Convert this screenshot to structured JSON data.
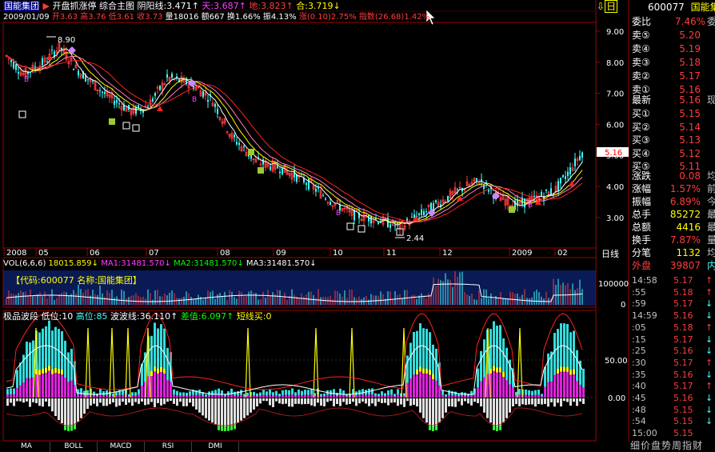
{
  "header": {
    "stock_name": "国能集团",
    "arrow": "▶",
    "items": [
      "开盘抓涨停",
      "综合主图"
    ],
    "yinyang_label": "阴阳线:",
    "yinyang_value": "3.471",
    "tian_label": "天:",
    "tian_value": "3.687",
    "di_label": "地:",
    "di_value": "3.823",
    "he_label": "合:",
    "he_value": "3.719",
    "top_right_icon": "⇩",
    "top_right_text": "日"
  },
  "ohlc": {
    "date": "2009/01/09",
    "open_label": "开",
    "open": "3.63",
    "high_label": "高",
    "high": "3.76",
    "low_label": "低",
    "low": "3.61",
    "close_label": "收",
    "close": "3.73",
    "vol_label": "量",
    "vol": "18016",
    "amt_label": "额",
    "amt": "667",
    "turn_label": "换",
    "turn": "1.66%",
    "amp_label": "振",
    "amp": "4.13%",
    "chg_label": "涨",
    "chg": "(0.10)2.75%",
    "idx_label": "指数",
    "idx": "(26.68)1.42%"
  },
  "price_chart": {
    "y_ticks": [
      "9.00",
      "8.00",
      "7.00",
      "6.00",
      "5.00",
      "4.00",
      "3.00"
    ],
    "current_price": "5.16",
    "max_label": "8.90",
    "min_label": "2.44",
    "x_labels": [
      "2008",
      "05",
      "06",
      "07",
      "08",
      "09",
      "10",
      "11",
      "12",
      "2009",
      "02"
    ],
    "period": "日线"
  },
  "volume": {
    "label": "VOL(6,6,6)",
    "vol": "18015.859",
    "ma1_label": "MA1:",
    "ma1": "31481.570",
    "ma2_label": "MA2:",
    "ma2": "31481.570",
    "ma3_label": "MA3:",
    "ma3": "31481.570",
    "code_banner": "【代码:600077 名称:国能集团】",
    "y_ticks": [
      "100000",
      "0"
    ]
  },
  "indicator": {
    "name": "极品波段",
    "low_label": "低位:",
    "low": "10",
    "high_label": "高位:",
    "high": "85",
    "wave_label": "波波线:",
    "wave": "36.110",
    "diff_label": "差值:",
    "diff": "6.097",
    "short_label": "短线买:",
    "short": "0",
    "y_ticks": [
      "50.00",
      "0.00"
    ]
  },
  "tabs": [
    "MA",
    "BOLL",
    "MACD",
    "RSI",
    "DMI"
  ],
  "quote": {
    "code": "600077",
    "name": "国能集",
    "weibi_label": "委比",
    "weibi": "7.46%",
    "weicha": "委差",
    "sells": [
      {
        "label": "卖⑤",
        "price": "5.20"
      },
      {
        "label": "卖④",
        "price": "5.19"
      },
      {
        "label": "卖③",
        "price": "5.18"
      },
      {
        "label": "卖②",
        "price": "5.17"
      },
      {
        "label": "卖①",
        "price": "5.16"
      }
    ],
    "latest_label": "最新",
    "latest": "5.16",
    "latest_extra": "现手",
    "buys": [
      {
        "label": "买①",
        "price": "5.15"
      },
      {
        "label": "买②",
        "price": "5.14"
      },
      {
        "label": "买③",
        "price": "5.13"
      },
      {
        "label": "买④",
        "price": "5.12"
      },
      {
        "label": "买⑤",
        "price": "5.11"
      }
    ],
    "stats": [
      {
        "label": "涨跌",
        "value": "0.08",
        "extra": "均价"
      },
      {
        "label": "涨幅",
        "value": "1.57%",
        "extra": "前收"
      },
      {
        "label": "振幅",
        "value": "6.89%",
        "extra": "今开"
      },
      {
        "label": "总手",
        "value": "85272",
        "extra": "最高"
      },
      {
        "label": "总额",
        "value": "4416",
        "extra": "最低"
      },
      {
        "label": "换手",
        "value": "7.87%",
        "extra": "量比"
      },
      {
        "label": "分笔",
        "value": "1132",
        "extra": "均量"
      }
    ],
    "outer_label": "外盘",
    "outer": "39807",
    "inner": "内盘",
    "ticks": [
      {
        "time": "14:58",
        "price": "5.17",
        "dir": "↑"
      },
      {
        "time": ":55",
        "price": "5.18",
        "dir": "↑"
      },
      {
        "time": ":59",
        "price": "5.17",
        "dir": "↓"
      },
      {
        "time": "14:59",
        "price": "5.16",
        "dir": "↓"
      },
      {
        "time": ":05",
        "price": "5.18",
        "dir": "↑"
      },
      {
        "time": ":15",
        "price": "5.17",
        "dir": "↓"
      },
      {
        "time": ":25",
        "price": "5.16",
        "dir": "↓"
      },
      {
        "time": ":30",
        "price": "5.17",
        "dir": "↑"
      },
      {
        "time": ":35",
        "price": "5.16",
        "dir": "↓"
      },
      {
        "time": ":40",
        "price": "5.17",
        "dir": "↑"
      },
      {
        "time": ":45",
        "price": "5.16",
        "dir": "↓"
      },
      {
        "time": ":48",
        "price": "5.15",
        "dir": "↓"
      },
      {
        "time": ":54",
        "price": "5.15",
        "dir": "↓"
      },
      {
        "time": "15:00",
        "price": "5.15",
        "dir": ""
      }
    ],
    "bottom_tabs": "细价盘势周指财"
  },
  "colors": {
    "up": "#ff3c3c",
    "down": "#40ffff",
    "ma_white": "#ffffff",
    "ma_yellow": "#ffff00",
    "ma_pink": "#ff80c0",
    "ma_red": "#ff2020",
    "magenta": "#ff00ff"
  }
}
